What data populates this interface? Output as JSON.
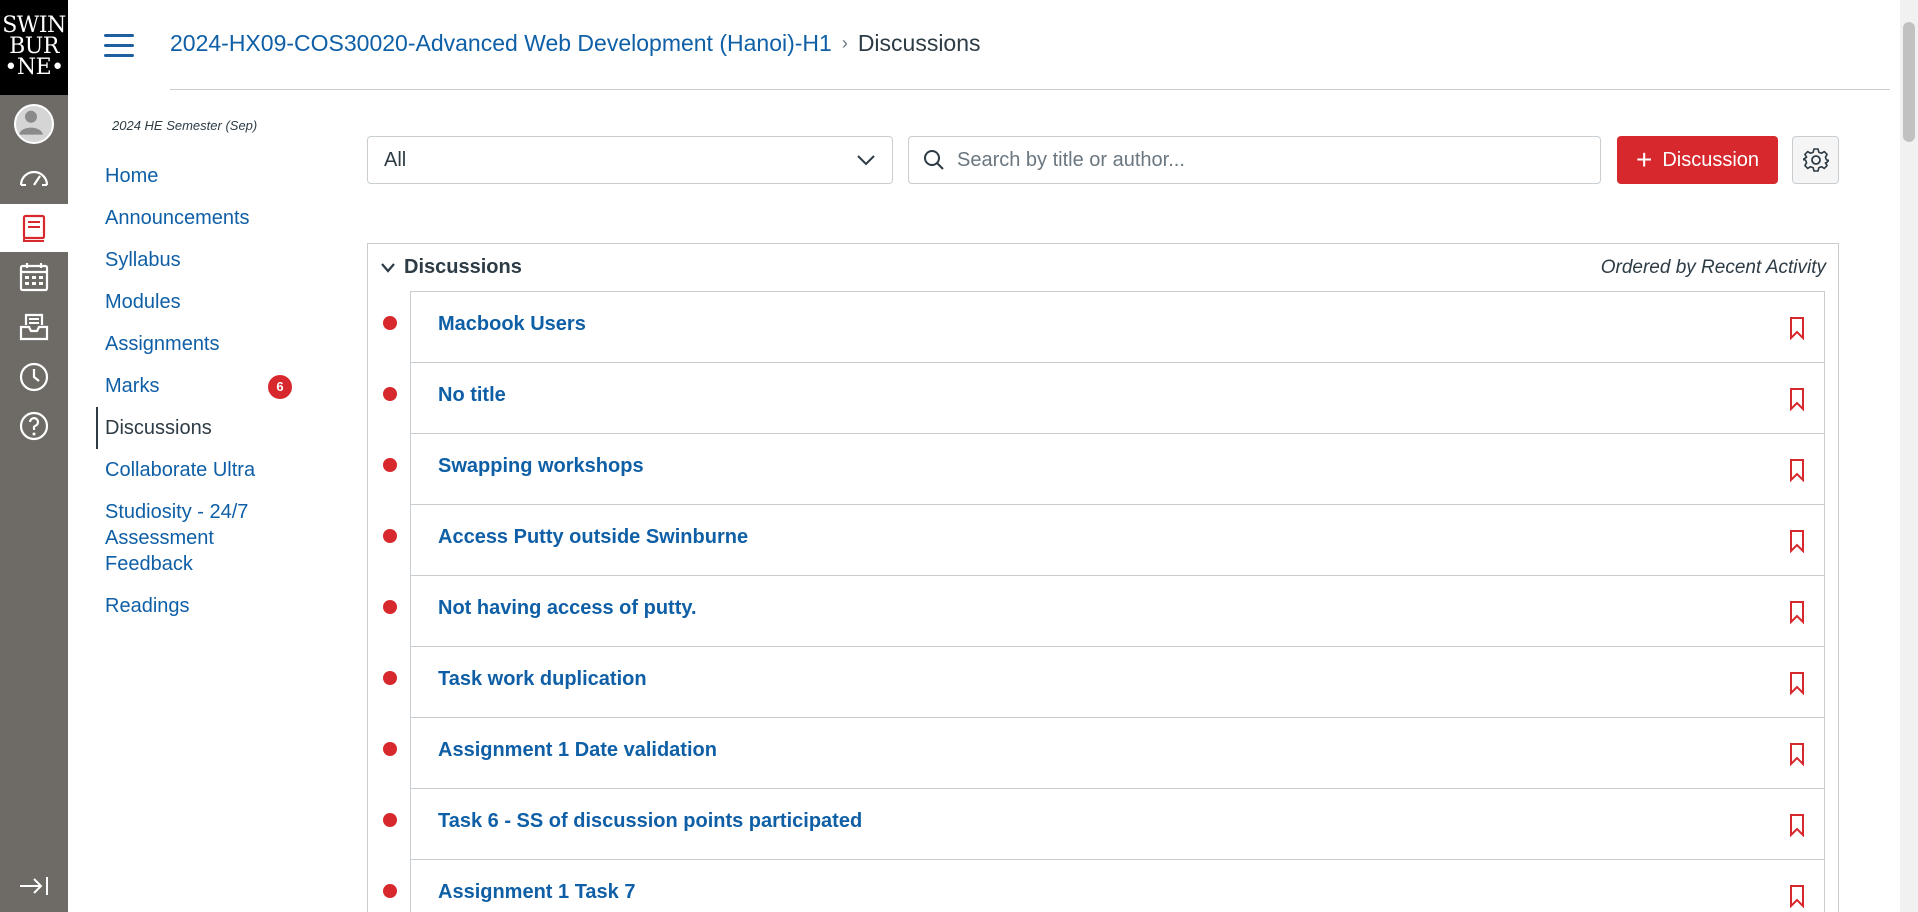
{
  "brand": {
    "logo_lines": [
      "SWIN",
      "BUR",
      "•NE•"
    ]
  },
  "global_nav": {
    "items": [
      {
        "name": "account",
        "icon": "avatar-icon"
      },
      {
        "name": "dashboard",
        "icon": "dashboard-icon"
      },
      {
        "name": "courses",
        "icon": "courses-icon",
        "active": true
      },
      {
        "name": "calendar",
        "icon": "calendar-icon"
      },
      {
        "name": "inbox",
        "icon": "inbox-icon"
      },
      {
        "name": "history",
        "icon": "history-icon"
      },
      {
        "name": "help",
        "icon": "help-icon"
      }
    ],
    "collapse_icon": "collapse-nav-icon"
  },
  "header": {
    "course_link": "2024-HX09-COS30020-Advanced Web Development (Hanoi)-H1",
    "separator": "›",
    "current_page": "Discussions"
  },
  "course_nav": {
    "term": "2024 HE Semester (Sep)",
    "items": [
      {
        "label": "Home"
      },
      {
        "label": "Announcements"
      },
      {
        "label": "Syllabus"
      },
      {
        "label": "Modules"
      },
      {
        "label": "Assignments"
      },
      {
        "label": "Marks",
        "badge": "6"
      },
      {
        "label": "Discussions",
        "active": true
      },
      {
        "label": "Collaborate Ultra"
      },
      {
        "label": "Studiosity - 24/7 Assessment Feedback"
      },
      {
        "label": "Readings"
      }
    ]
  },
  "toolbar": {
    "filter_value": "All",
    "search_placeholder": "Search by title or author...",
    "add_button_plus": "+",
    "add_button_label": "Discussion"
  },
  "discussions": {
    "section_title": "Discussions",
    "order_label": "Ordered by Recent Activity",
    "items": [
      {
        "title": "Macbook Users"
      },
      {
        "title": "No title"
      },
      {
        "title": "Swapping workshops"
      },
      {
        "title": "Access Putty outside Swinburne"
      },
      {
        "title": "Not having access of putty."
      },
      {
        "title": "Task work duplication"
      },
      {
        "title": "Assignment 1 Date validation"
      },
      {
        "title": "Task 6 - SS of discussion points participated"
      },
      {
        "title": "Assignment 1 Task 7"
      }
    ]
  },
  "colors": {
    "rail": "#6e6a66",
    "link": "#0f5fa6",
    "accent_red": "#d7282d",
    "border": "#c7cdd1"
  }
}
